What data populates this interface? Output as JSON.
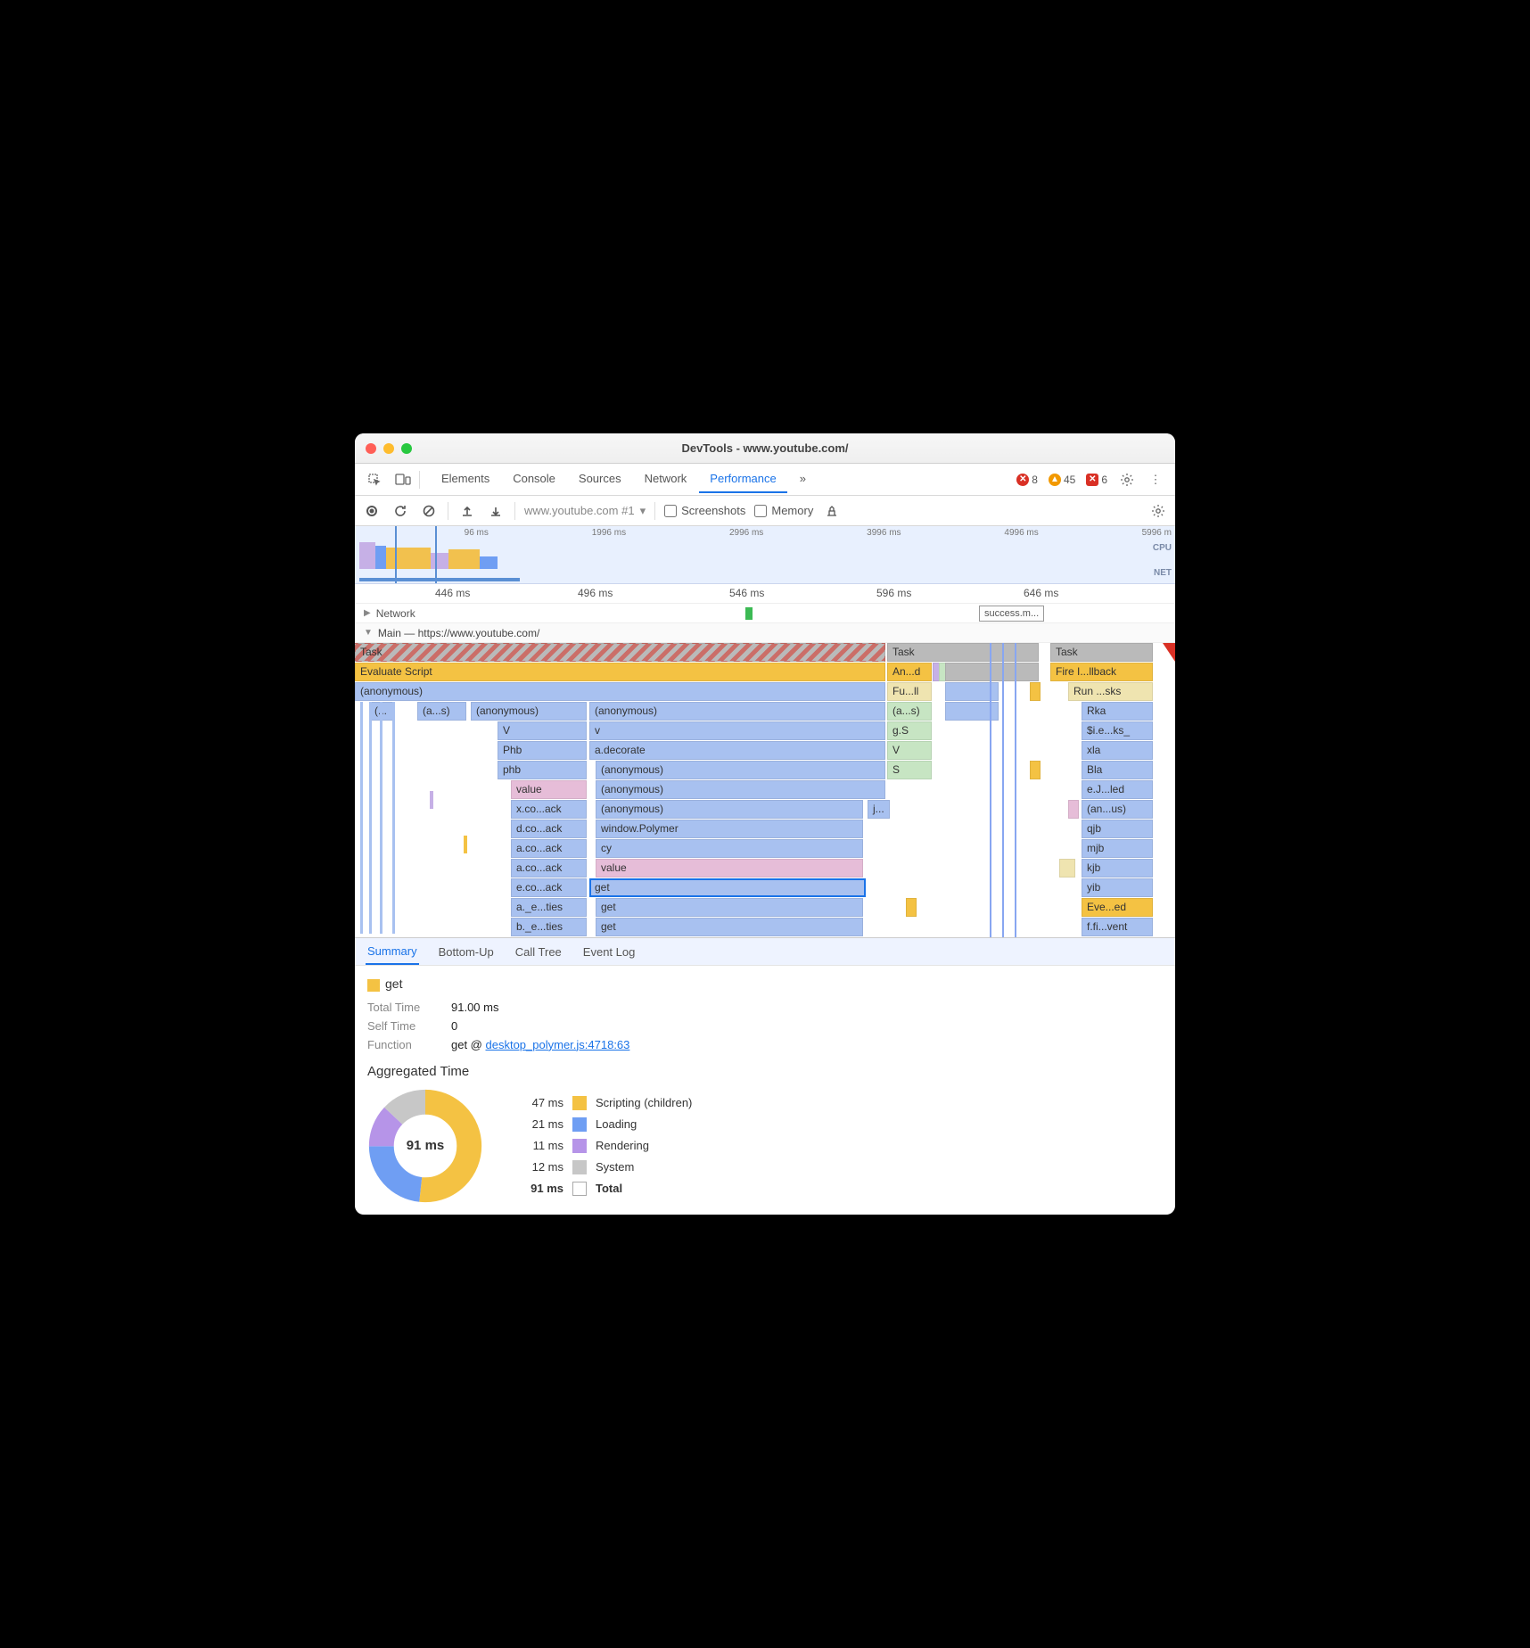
{
  "window": {
    "title": "DevTools - www.youtube.com/"
  },
  "mainTabs": {
    "t0": "Elements",
    "t1": "Console",
    "t2": "Sources",
    "t3": "Network",
    "t4": "Performance"
  },
  "badges": {
    "errors": "8",
    "warnings": "45",
    "blocked": "6"
  },
  "toolbar": {
    "target": "www.youtube.com #1",
    "screenshots": "Screenshots",
    "memory": "Memory"
  },
  "overview": {
    "ticks": [
      "96 ms",
      "1996 ms",
      "2996 ms",
      "3996 ms",
      "4996 ms",
      "5996 m"
    ],
    "cpu": "CPU",
    "net": "NET"
  },
  "ruler": {
    "t0": "446 ms",
    "t1": "496 ms",
    "t2": "546 ms",
    "t3": "596 ms",
    "t4": "646 ms"
  },
  "network": {
    "label": "Network",
    "pill": "success.m..."
  },
  "main": {
    "label": "Main — https://www.youtube.com/",
    "task": "Task",
    "eval": "Evaluate Script",
    "anond": "An...d",
    "firecb": "Fire I...llback",
    "anon": "(anonymous)",
    "full": "Fu...ll",
    "runsks": "Run ...sks",
    "p": "(...",
    "as": "(a...s)",
    "anonymous": "(anonymous)",
    "gs": "g.S",
    "rka": "Rka",
    "ieks": "$i.e...ks_",
    "V": "V",
    "v": "v",
    "Phb": "Phb",
    "adecorate": "a.decorate",
    "xla": "xla",
    "phb": "phb",
    "S": "S",
    "Bla": "Bla",
    "value": "value",
    "ejled": "e.J...led",
    "xcoack": "x.co...ack",
    "anus": "(an...us)",
    "dcoack": "d.co...ack",
    "windowpolymer": "window.Polymer",
    "j": "j...",
    "qjb": "qjb",
    "acoack": "a.co...ack",
    "cy": "cy",
    "mjb": "mjb",
    "kjb": "kjb",
    "ecoack": "e.co...ack",
    "get": "get",
    "yib": "yib",
    "aeties": "a._e...ties",
    "evented": "Eve...ed",
    "beties": "b._e...ties",
    "ffivent": "f.fi...vent"
  },
  "detailTabs": {
    "summary": "Summary",
    "bottomup": "Bottom-Up",
    "calltree": "Call Tree",
    "eventlog": "Event Log"
  },
  "summary": {
    "name": "get",
    "totalTimeLabel": "Total Time",
    "totalTime": "91.00 ms",
    "selfTimeLabel": "Self Time",
    "selfTime": "0",
    "functionLabel": "Function",
    "functionPrefix": "get @ ",
    "functionLink": "desktop_polymer.js:4718:63",
    "aggTitle": "Aggregated Time",
    "donutCenter": "91 ms",
    "legend": [
      {
        "t": "47 ms",
        "c": "#f4c243",
        "n": "Scripting (children)"
      },
      {
        "t": "21 ms",
        "c": "#6f9ef3",
        "n": "Loading"
      },
      {
        "t": "11 ms",
        "c": "#b694e8",
        "n": "Rendering"
      },
      {
        "t": "12 ms",
        "c": "#c7c7c7",
        "n": "System"
      }
    ],
    "totalLabel": "91 ms",
    "totalName": "Total"
  },
  "chart_data": {
    "type": "pie",
    "title": "Aggregated Time",
    "series": [
      {
        "name": "get",
        "values": [
          47,
          21,
          11,
          12
        ]
      }
    ],
    "categories": [
      "Scripting (children)",
      "Loading",
      "Rendering",
      "System"
    ],
    "total": 91,
    "unit": "ms"
  }
}
